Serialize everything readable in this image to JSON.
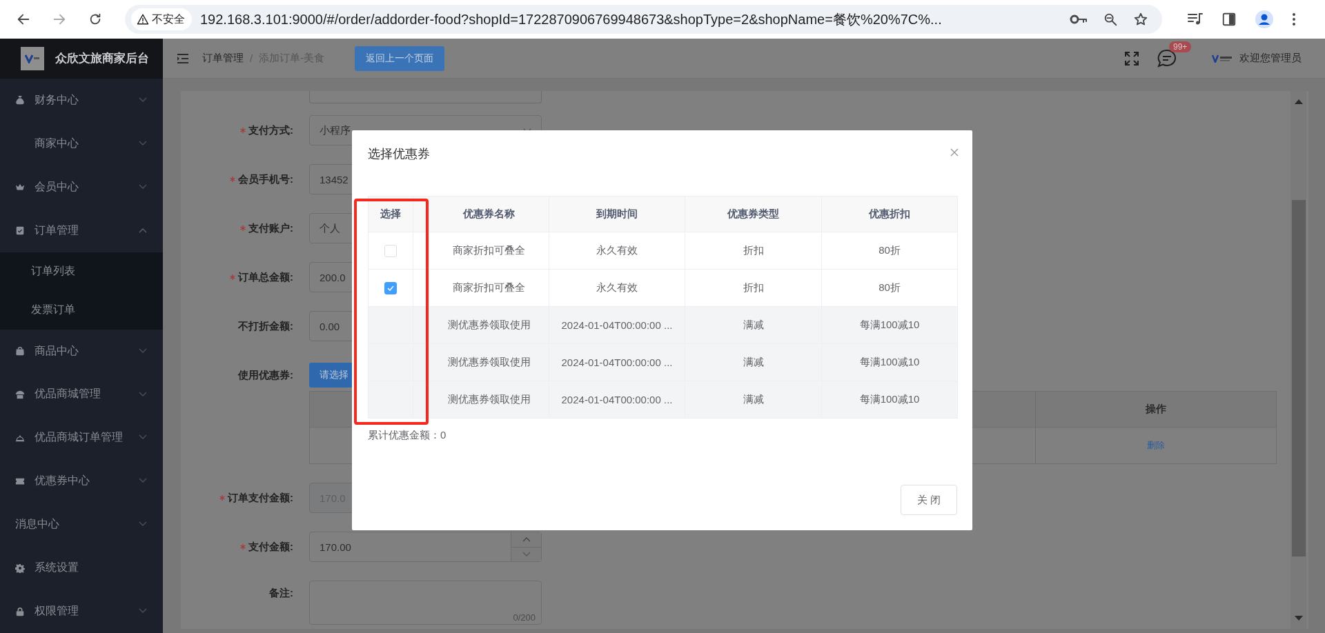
{
  "browser": {
    "security_label": "不安全",
    "url": "192.168.3.101:9000/#/order/addorder-food?shopId=1722870906769948673&shopType=2&shopName=餐饮%20%7C%..."
  },
  "sidebar": {
    "brand": "众欣文旅商家后台",
    "items": [
      {
        "label": "财务中心",
        "expanded": false
      },
      {
        "label": "商家中心",
        "expanded": false
      },
      {
        "label": "会员中心",
        "expanded": false
      },
      {
        "label": "订单管理",
        "expanded": true,
        "children": [
          {
            "label": "订单列表"
          },
          {
            "label": "发票订单"
          }
        ]
      },
      {
        "label": "商品中心",
        "expanded": false
      },
      {
        "label": "优品商城管理",
        "expanded": false
      },
      {
        "label": "优品商城订单管理",
        "expanded": false
      },
      {
        "label": "优惠券中心",
        "expanded": false
      },
      {
        "label": "消息中心",
        "expanded": false
      },
      {
        "label": "系统设置"
      },
      {
        "label": "权限管理",
        "expanded": false
      }
    ]
  },
  "header": {
    "breadcrumb": [
      {
        "label": "订单管理",
        "current": false
      },
      {
        "label": "添加订单-美食",
        "current": true
      }
    ],
    "breadcrumb_separator": "/",
    "back_button": "返回上一个页面",
    "message_badge": "99+",
    "greeting": "欢迎您管理员"
  },
  "form": {
    "fields": [
      {
        "kind": "select",
        "label": "支付方式:",
        "required": true,
        "value": "小程序"
      },
      {
        "kind": "input",
        "label": "会员手机号:",
        "required": true,
        "value": "13452"
      },
      {
        "kind": "input",
        "label": "支付账户:",
        "required": true,
        "value": "个人"
      },
      {
        "kind": "input",
        "label": "订单总金额:",
        "required": true,
        "value": "200.0"
      },
      {
        "kind": "input",
        "label": "不打折金额:",
        "value": "0.00"
      },
      {
        "kind": "coupon",
        "label": "使用优惠券:",
        "button": "请选择",
        "table": {
          "header": "操作",
          "rows": [
            {
              "action": "删除"
            }
          ]
        }
      },
      {
        "kind": "input",
        "label": "订单支付金额:",
        "required": true,
        "disabled": true,
        "value": "170.0"
      },
      {
        "kind": "number",
        "label": "支付金额:",
        "required": true,
        "value": "170.00"
      },
      {
        "kind": "textarea",
        "label": "备注:",
        "counter": "0/200"
      }
    ]
  },
  "dialog": {
    "title": "选择优惠券",
    "columns": [
      {
        "label": "选择"
      },
      {
        "label": "优惠券名称"
      },
      {
        "label": "到期时间"
      },
      {
        "label": "优惠券类型"
      },
      {
        "label": "优惠折扣"
      }
    ],
    "rows": [
      {
        "selectable": true,
        "checked": false,
        "name": "商家折扣可叠全",
        "expiry": "永久有效",
        "type": "折扣",
        "discount": "80折"
      },
      {
        "selectable": true,
        "checked": true,
        "name": "商家折扣可叠全",
        "expiry": "永久有效",
        "type": "折扣",
        "discount": "80折"
      },
      {
        "selectable": false,
        "name": "测优惠券领取使用",
        "expiry": "2024-01-04T00:00:00 ...",
        "type": "满减",
        "discount": "每满100减10"
      },
      {
        "selectable": false,
        "name": "测优惠券领取使用",
        "expiry": "2024-01-04T00:00:00 ...",
        "type": "满减",
        "discount": "每满100减10"
      },
      {
        "selectable": false,
        "name": "测优惠券领取使用",
        "expiry": "2024-01-04T00:00:00 ...",
        "type": "满减",
        "discount": "每满100减10"
      }
    ],
    "total": "累计优惠金额：0",
    "close_button": "关 闭",
    "highlight_select_column": true
  }
}
